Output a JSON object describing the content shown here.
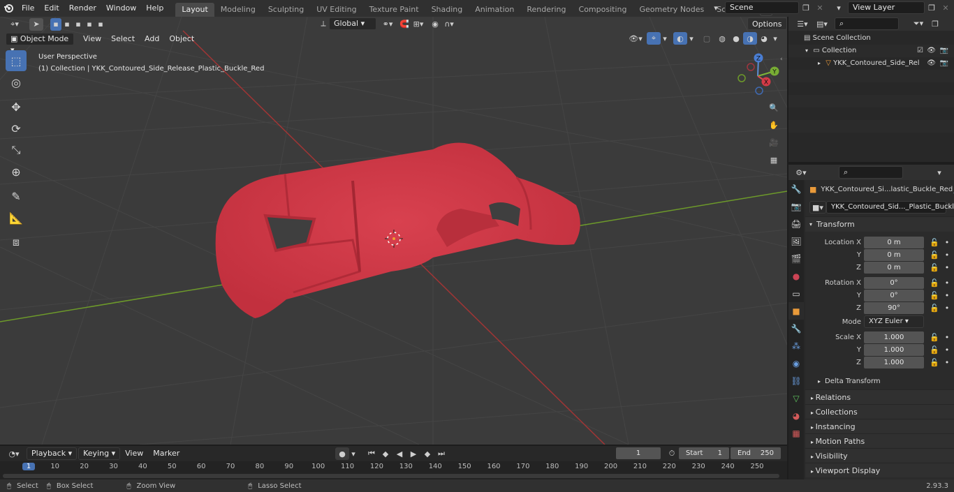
{
  "topbar": {
    "menus": [
      "File",
      "Edit",
      "Render",
      "Window",
      "Help"
    ],
    "workspaces": [
      "Layout",
      "Modeling",
      "Sculpting",
      "UV Editing",
      "Texture Paint",
      "Shading",
      "Animation",
      "Rendering",
      "Compositing",
      "Geometry Nodes",
      "Scripting"
    ],
    "scene": "Scene",
    "view_layer": "View Layer"
  },
  "viewport": {
    "mode": "Object Mode",
    "menus": [
      "View",
      "Select",
      "Add",
      "Object"
    ],
    "orientation": "Global",
    "options": "Options",
    "perspective_label": "User Perspective",
    "collection_label": "(1) Collection | YKK_Contoured_Side_Release_Plastic_Buckle_Red",
    "gizmo_axes": {
      "x": "X",
      "y": "Y",
      "z": "Z"
    }
  },
  "outliner": {
    "rows": [
      {
        "label": "Scene Collection"
      },
      {
        "label": "Collection"
      },
      {
        "label": "YKK_Contoured_Side_Rel"
      }
    ]
  },
  "properties": {
    "object_name": "YKK_Contoured_Si...lastic_Buckle_Red",
    "data_name": "YKK_Contoured_Sid..._Plastic_Buckle_Red",
    "transform_title": "Transform",
    "location_label": "Location X",
    "rotation_label": "Rotation X",
    "scale_label": "Scale X",
    "axis_y": "Y",
    "axis_z": "Z",
    "location": [
      "0 m",
      "0 m",
      "0 m"
    ],
    "rotation": [
      "0°",
      "0°",
      "90°"
    ],
    "mode_label": "Mode",
    "mode_value": "XYZ Euler",
    "scale": [
      "1.000",
      "1.000",
      "1.000"
    ],
    "delta": "Delta Transform",
    "panels": [
      "Relations",
      "Collections",
      "Instancing",
      "Motion Paths",
      "Visibility",
      "Viewport Display"
    ]
  },
  "timeline": {
    "menus": [
      "Playback",
      "Keying",
      "View",
      "Marker"
    ],
    "current_frame": "1",
    "start_label": "Start",
    "start": "1",
    "end_label": "End",
    "end": "250",
    "ruler": [
      "1",
      "10",
      "20",
      "30",
      "40",
      "50",
      "60",
      "70",
      "80",
      "90",
      "100",
      "110",
      "120",
      "130",
      "140",
      "150",
      "160",
      "170",
      "180",
      "190",
      "200",
      "210",
      "220",
      "230",
      "240",
      "250"
    ]
  },
  "statusbar": {
    "select": "Select",
    "box_select": "Box Select",
    "zoom_view": "Zoom View",
    "lasso_select": "Lasso Select",
    "version": "2.93.3"
  },
  "colors": {
    "accent": "#4772b3",
    "object_red": "#cf3a48",
    "x_axis": "#a03535",
    "y_axis": "#6d9a2a"
  }
}
